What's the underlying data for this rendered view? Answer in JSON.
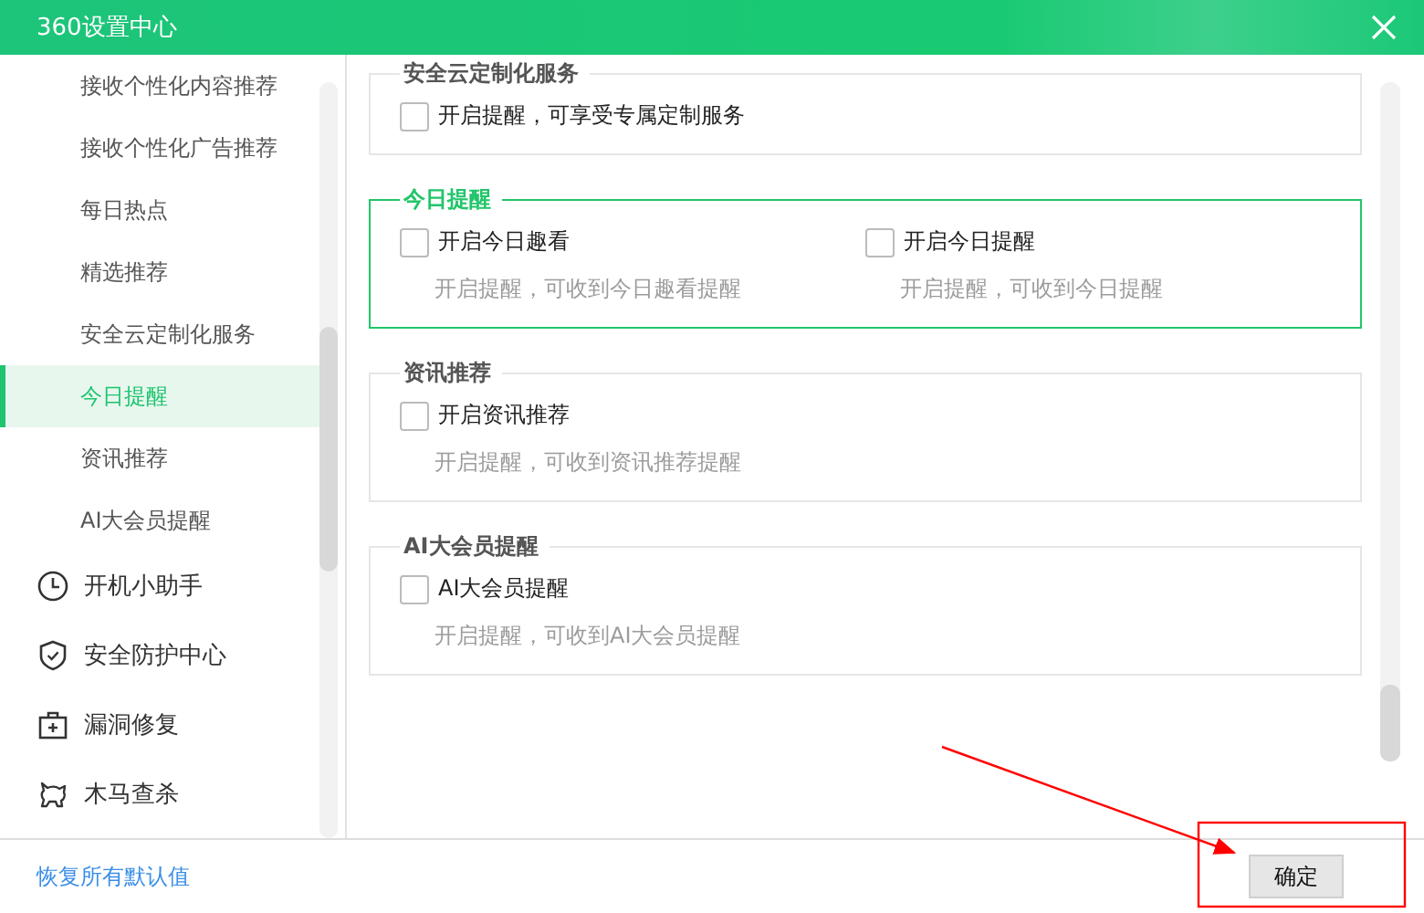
{
  "window": {
    "title": "360设置中心"
  },
  "sidebar": {
    "items": [
      {
        "label": "接收个性化内容推荐",
        "kind": "sub",
        "selected": false
      },
      {
        "label": "接收个性化广告推荐",
        "kind": "sub",
        "selected": false
      },
      {
        "label": "每日热点",
        "kind": "sub",
        "selected": false
      },
      {
        "label": "精选推荐",
        "kind": "sub",
        "selected": false
      },
      {
        "label": "安全云定制化服务",
        "kind": "sub",
        "selected": false
      },
      {
        "label": "今日提醒",
        "kind": "sub",
        "selected": true
      },
      {
        "label": "资讯推荐",
        "kind": "sub",
        "selected": false
      },
      {
        "label": "AI大会员提醒",
        "kind": "sub",
        "selected": false
      },
      {
        "label": "开机小助手",
        "kind": "section",
        "selected": false
      },
      {
        "label": "安全防护中心",
        "kind": "section",
        "selected": false
      },
      {
        "label": "漏洞修复",
        "kind": "section",
        "selected": false
      },
      {
        "label": "木马查杀",
        "kind": "section",
        "selected": false
      }
    ]
  },
  "groups": [
    {
      "title": "安全云定制化服务",
      "active": false,
      "options": [
        {
          "label": "开启提醒，可享受专属定制服务",
          "checked": false
        }
      ]
    },
    {
      "title": "今日提醒",
      "active": true,
      "options": [
        {
          "label": "开启今日趣看",
          "description": "开启提醒，可收到今日趣看提醒",
          "checked": false
        },
        {
          "label": "开启今日提醒",
          "description": "开启提醒，可收到今日提醒",
          "checked": false
        }
      ]
    },
    {
      "title": "资讯推荐",
      "active": false,
      "options": [
        {
          "label": "开启资讯推荐",
          "description": "开启提醒，可收到资讯推荐提醒",
          "checked": false
        }
      ]
    },
    {
      "title": "AI大会员提醒",
      "active": false,
      "options": [
        {
          "label": "AI大会员提醒",
          "description": "开启提醒，可收到AI大会员提醒",
          "checked": false
        }
      ]
    }
  ],
  "footer": {
    "reset_link": "恢复所有默认值",
    "confirm_button": "确定"
  }
}
